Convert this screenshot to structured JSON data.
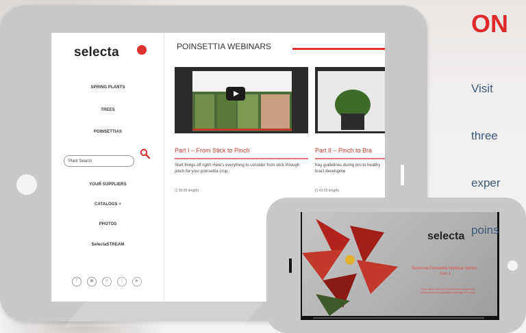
{
  "tablet": {
    "sidebar": {
      "logo": "selecta",
      "nav": [
        {
          "label": "SPRING PLANTS"
        },
        {
          "label": "TREES"
        },
        {
          "label": "POINSETTIAS"
        },
        {
          "label": "YOUR SUPPLIERS"
        },
        {
          "label": "CATALOGS +"
        },
        {
          "label": "PHOTOS"
        },
        {
          "label": "SelectaSTREAM"
        }
      ],
      "search_placeholder": "Plant Search",
      "social_icons": [
        "facebook-icon",
        "instagram-icon",
        "linkedin-icon",
        "twitter-icon",
        "youtube-icon"
      ]
    },
    "main": {
      "page_title": "POINSETTIA WEBINARS",
      "videos": [
        {
          "title": "Part I – From Stick to Pinch",
          "description": "Start things off right! Here's everything to consider from stick through pinch for your poinsettia crop.",
          "length": "(1:30:35 length)"
        },
        {
          "title": "Part II – Pinch to Bra",
          "description": "Key guidelines during pro to healthy bract developme",
          "length": "(1:43:23 length)"
        }
      ]
    }
  },
  "phone": {
    "slide_logo": "selecta",
    "slide_title": "Technical Poinsettia Webinar Series - Part 1",
    "slide_subtitle": "From stick Through Pinch Best management practices from propagation through the pinch"
  },
  "right_panel": {
    "heading": "ON",
    "lines": [
      "Visit",
      "three",
      "exper",
      "poins"
    ]
  },
  "colors": {
    "accent": "#e02a2a",
    "body_text": "#3d5a78",
    "device": "#c9c9c9"
  }
}
